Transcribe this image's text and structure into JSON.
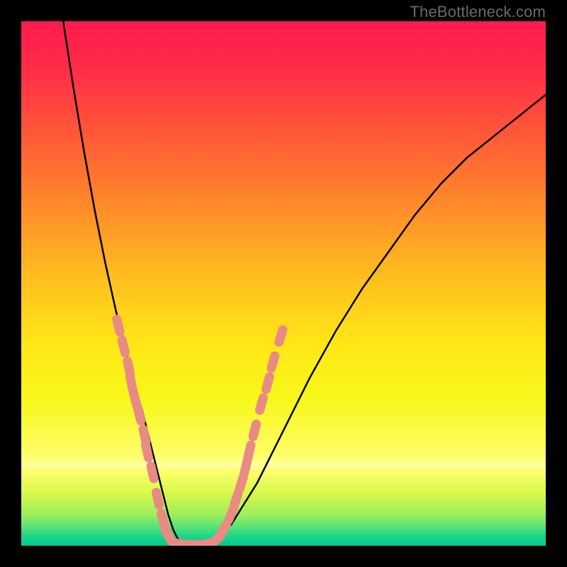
{
  "attribution": "TheBottleneck.com",
  "chart_data": {
    "type": "line",
    "title": "",
    "xlabel": "",
    "ylabel": "",
    "xlim": [
      0,
      100
    ],
    "ylim": [
      0,
      100
    ],
    "series": [
      {
        "name": "bottleneck-curve",
        "x": [
          8,
          10,
          12,
          14,
          16,
          18,
          20,
          21,
          22,
          23,
          24,
          25,
          26,
          27,
          28,
          29,
          30,
          32,
          36,
          40,
          45,
          50,
          55,
          60,
          65,
          70,
          75,
          80,
          85,
          90,
          95,
          100
        ],
        "values": [
          100,
          87,
          75,
          64,
          54,
          45,
          37,
          33,
          29,
          26,
          22,
          18,
          14,
          10,
          6,
          3,
          1,
          0,
          0,
          4,
          12,
          22,
          32,
          41,
          49,
          56,
          63,
          69,
          74,
          78,
          82,
          86
        ]
      }
    ],
    "markers": {
      "name": "salmon-dots",
      "color": "#e98a85",
      "points": [
        {
          "x": 18.5,
          "y": 42
        },
        {
          "x": 19.5,
          "y": 38
        },
        {
          "x": 20.5,
          "y": 34
        },
        {
          "x": 21.0,
          "y": 31
        },
        {
          "x": 21.7,
          "y": 28
        },
        {
          "x": 22.5,
          "y": 25
        },
        {
          "x": 23.5,
          "y": 21
        },
        {
          "x": 24.0,
          "y": 18
        },
        {
          "x": 25.0,
          "y": 14
        },
        {
          "x": 26.0,
          "y": 9
        },
        {
          "x": 27.0,
          "y": 5
        },
        {
          "x": 28.0,
          "y": 2
        },
        {
          "x": 29.5,
          "y": 0.5
        },
        {
          "x": 31.0,
          "y": 0.3
        },
        {
          "x": 33.0,
          "y": 0.2
        },
        {
          "x": 35.0,
          "y": 0.3
        },
        {
          "x": 37.0,
          "y": 1
        },
        {
          "x": 38.5,
          "y": 3
        },
        {
          "x": 40.0,
          "y": 6
        },
        {
          "x": 41.0,
          "y": 9
        },
        {
          "x": 42.0,
          "y": 12
        },
        {
          "x": 42.8,
          "y": 15
        },
        {
          "x": 43.5,
          "y": 18
        },
        {
          "x": 44.5,
          "y": 22
        },
        {
          "x": 45.8,
          "y": 27
        },
        {
          "x": 47.0,
          "y": 31
        },
        {
          "x": 48.0,
          "y": 35
        },
        {
          "x": 49.5,
          "y": 40
        }
      ]
    },
    "gradient_stops": [
      {
        "offset": 0.0,
        "color": "#ff1a50"
      },
      {
        "offset": 0.1,
        "color": "#ff2f47"
      },
      {
        "offset": 0.22,
        "color": "#ff5a37"
      },
      {
        "offset": 0.35,
        "color": "#ff8a2a"
      },
      {
        "offset": 0.5,
        "color": "#ffc21e"
      },
      {
        "offset": 0.62,
        "color": "#ffe816"
      },
      {
        "offset": 0.72,
        "color": "#f7f71a"
      },
      {
        "offset": 0.835,
        "color": "#ffff70"
      },
      {
        "offset": 0.845,
        "color": "#ffffb0"
      },
      {
        "offset": 0.855,
        "color": "#ffff70"
      },
      {
        "offset": 0.9,
        "color": "#d8f84a"
      },
      {
        "offset": 0.94,
        "color": "#9fef5a"
      },
      {
        "offset": 0.965,
        "color": "#55e27a"
      },
      {
        "offset": 0.985,
        "color": "#17d38c"
      },
      {
        "offset": 1.0,
        "color": "#00c98e"
      }
    ]
  }
}
